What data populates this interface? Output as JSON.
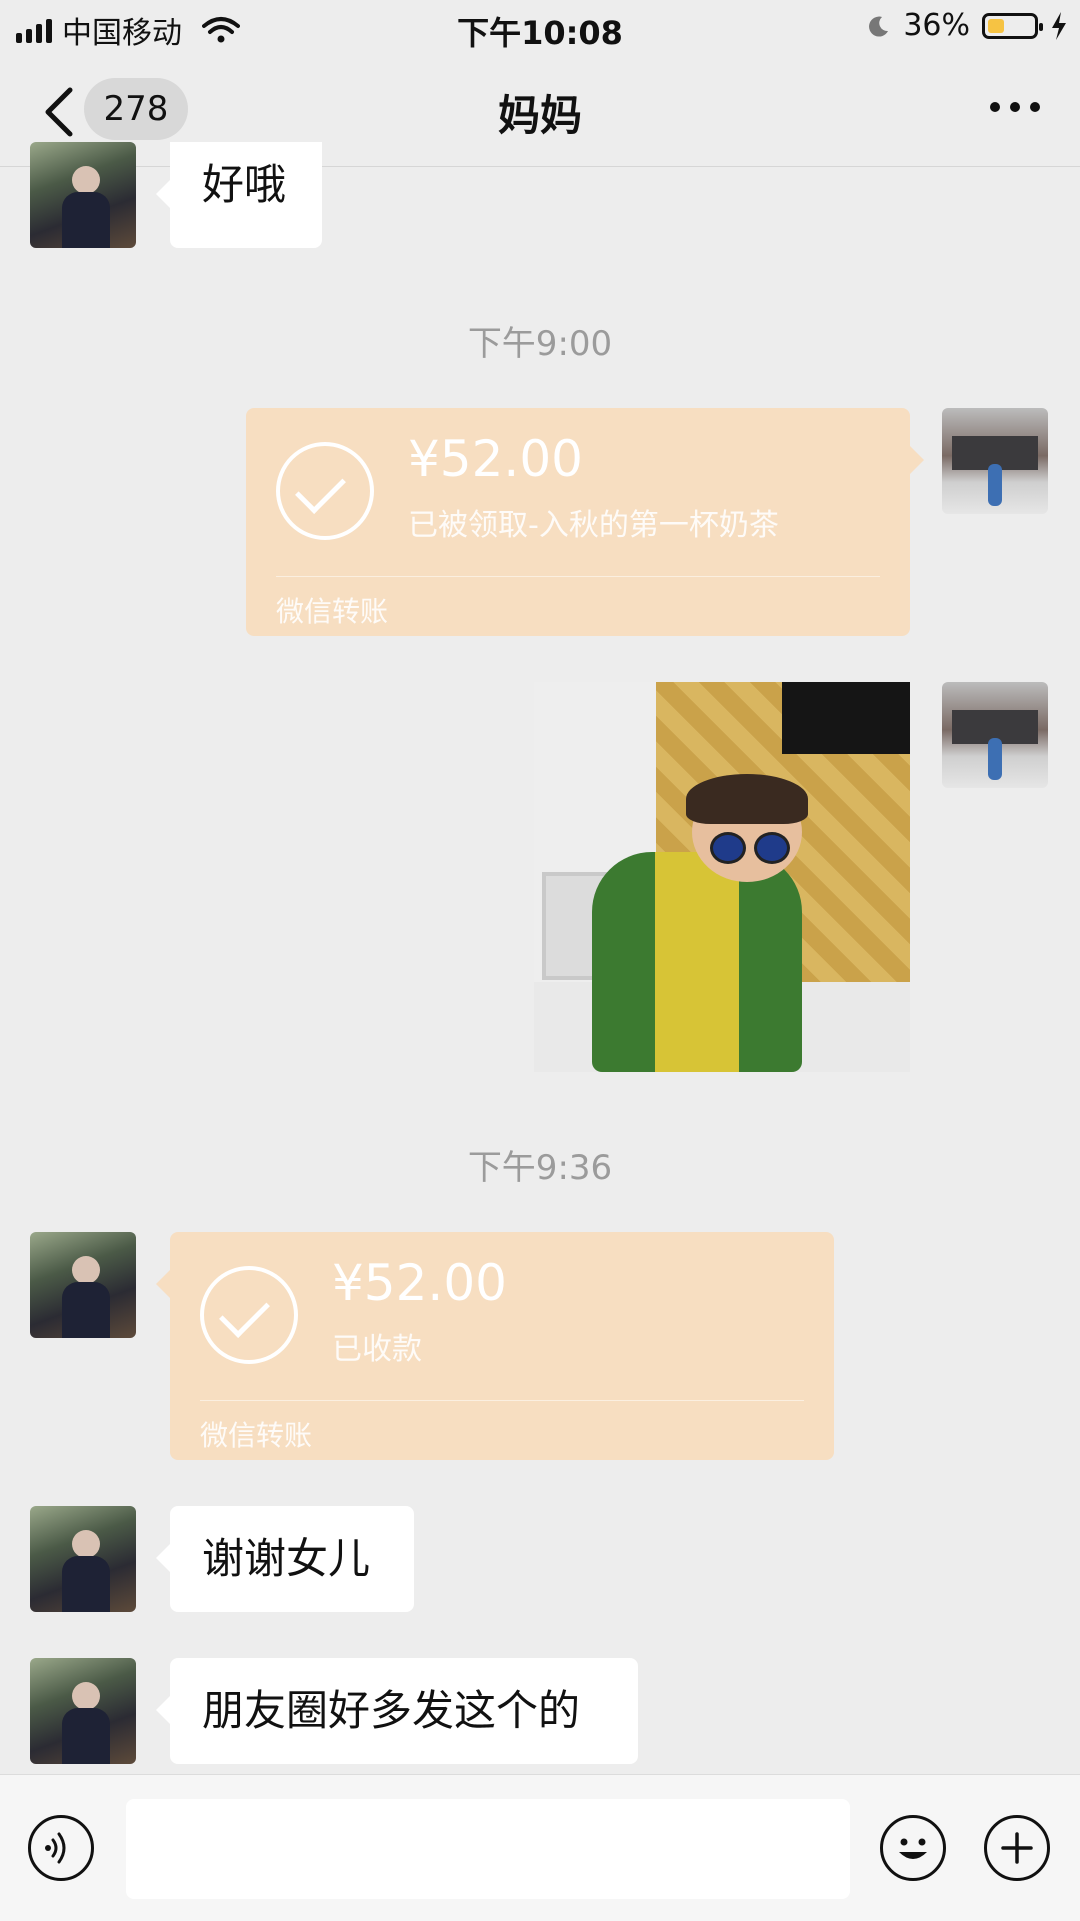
{
  "status_bar": {
    "carrier": "中国移动",
    "time": "下午10:08",
    "battery_percent": "36%",
    "battery_level": 0.36,
    "battery_color": "#f6c343"
  },
  "nav": {
    "unread_count": "278",
    "title": "妈妈",
    "icons": [
      "chevron-left-icon",
      "more-icon"
    ]
  },
  "chat": {
    "first_message": "好哦",
    "timestamp1": "下午9:00",
    "transfer_sent": {
      "amount": "¥52.00",
      "note": "已被领取-入秋的第一杯奶茶",
      "footer": "微信转账"
    },
    "timestamp2": "下午9:36",
    "transfer_received": {
      "amount": "¥52.00",
      "note": "已收款",
      "footer": "微信转账"
    },
    "message_thanks": "谢谢女儿",
    "message_moments": "朋友圈好多发这个的"
  },
  "colors": {
    "background": "#ededed",
    "transfer_bg": "#f7dec1",
    "bubble_bg": "#ffffff"
  },
  "input_bar": {
    "text_value": "",
    "icons": [
      "voice-icon",
      "emoji-icon",
      "add-icon"
    ]
  }
}
